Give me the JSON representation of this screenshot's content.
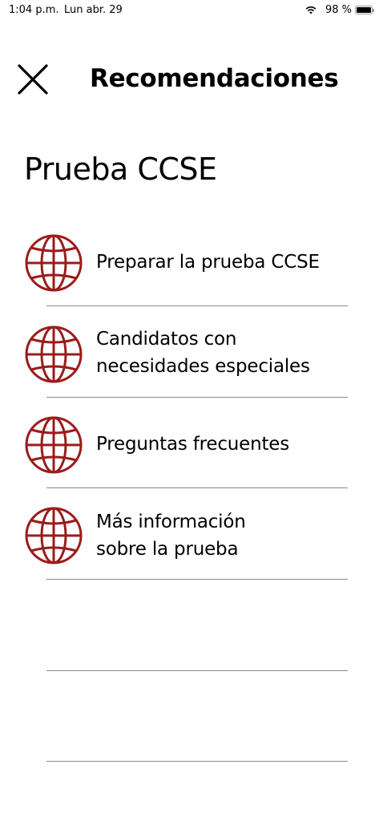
{
  "status_bar": {
    "time": "1:04 p.m.",
    "date": "Lun abr. 29",
    "battery": "98 %",
    "battery_level": 0.98,
    "wifi_icon": "wifi-icon",
    "battery_icon": "battery-icon"
  },
  "header": {
    "title": "Recomendaciones",
    "close_icon": "close-icon"
  },
  "section": {
    "title": "Prueba CCSE"
  },
  "menu": {
    "accent_color": "#9b1c1c",
    "items": [
      {
        "icon": "globe-icon",
        "line1": "Preparar la prueba CCSE",
        "line2": ""
      },
      {
        "icon": "globe-icon",
        "line1": "Candidatos con",
        "line2": "necesidades especiales"
      },
      {
        "icon": "globe-icon",
        "line1": "Preguntas frecuentes",
        "line2": ""
      },
      {
        "icon": "globe-icon",
        "line1": "Más información",
        "line2": "sobre la prueba"
      }
    ]
  }
}
